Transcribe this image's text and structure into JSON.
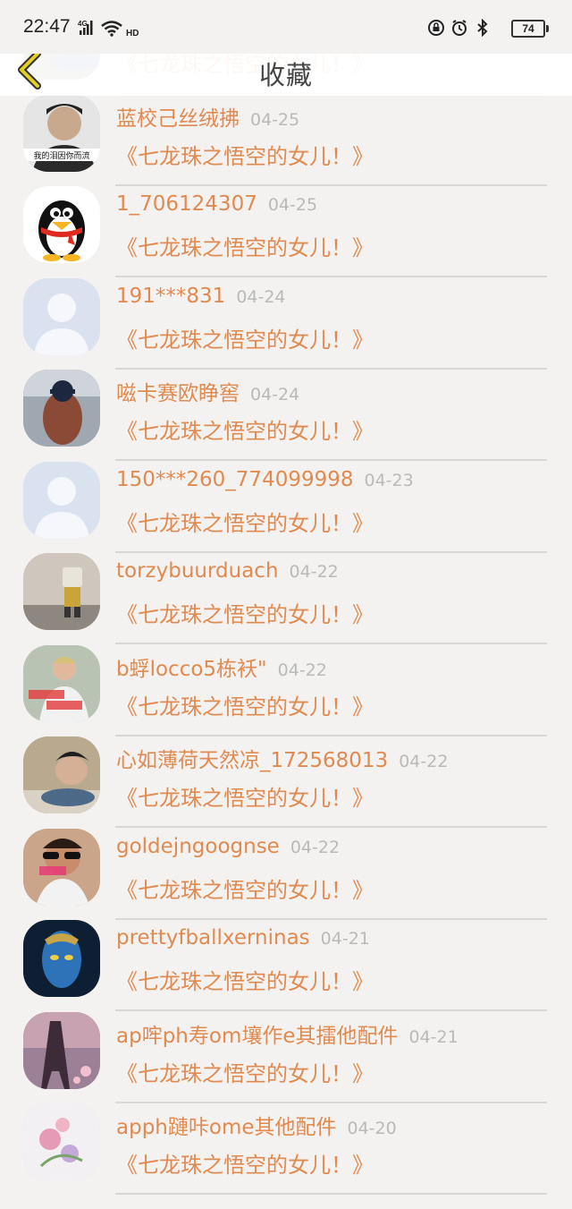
{
  "status_bar": {
    "time": "22:47",
    "network_label": "4G",
    "hd_label": "HD",
    "battery": "74"
  },
  "header": {
    "title": "收藏"
  },
  "items": [
    {
      "username": "",
      "date": "",
      "title": "《七龙珠之悟空的女儿！》",
      "avatar": "photo-rock"
    },
    {
      "username": "蓝校己丝绒拂",
      "date": "04-25",
      "title": "《七龙珠之悟空的女儿！》",
      "avatar": "photo-man",
      "avatar_caption": "我的泪因你而流"
    },
    {
      "username": "1_706124307",
      "date": "04-25",
      "title": "《七龙珠之悟空的女儿！》",
      "avatar": "penguin"
    },
    {
      "username": "191***831",
      "date": "04-24",
      "title": "《七龙珠之悟空的女儿！》",
      "avatar": "default"
    },
    {
      "username": "嗞卡赛欧睁窖",
      "date": "04-24",
      "title": "《七龙珠之悟空的女儿！》",
      "avatar": "photo-girl"
    },
    {
      "username": "150***260_774099998",
      "date": "04-23",
      "title": "《七龙珠之悟空的女儿！》",
      "avatar": "default"
    },
    {
      "username": "torzybuurduach",
      "date": "04-22",
      "title": "《七龙珠之悟空的女儿！》",
      "avatar": "photo-toy"
    },
    {
      "username": "b蜉locco5栋袄\"",
      "date": "04-22",
      "title": "《七龙珠之悟空的女儿！》",
      "avatar": "photo-boy"
    },
    {
      "username": "心如薄荷天然凉_172568013",
      "date": "04-22",
      "title": "《七龙珠之悟空的女儿！》",
      "avatar": "photo-lying"
    },
    {
      "username": "goldejngoognse",
      "date": "04-22",
      "title": "《七龙珠之悟空的女儿！》",
      "avatar": "photo-glasses"
    },
    {
      "username": "prettyfballxerninas",
      "date": "04-21",
      "title": "《七龙珠之悟空的女儿！》",
      "avatar": "photo-avatar-blue"
    },
    {
      "username": "ap哰ph寿om壤作e其擂他配件",
      "date": "04-21",
      "title": "《七龙珠之悟空的女儿！》",
      "avatar": "photo-tower"
    },
    {
      "username": "apph蹥咔ome其他配件",
      "date": "04-20",
      "title": "《七龙珠之悟空的女儿！》",
      "avatar": "photo-flowers"
    }
  ]
}
